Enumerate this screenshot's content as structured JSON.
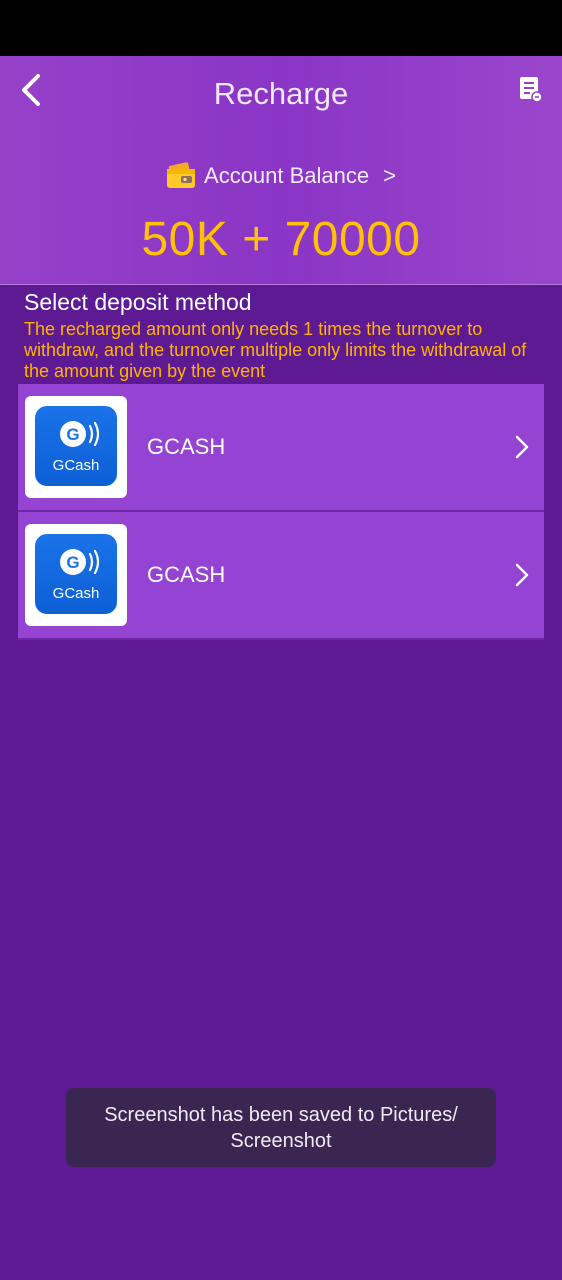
{
  "header": {
    "title": "Recharge",
    "balance_label": "Account Balance",
    "balance_arrow": ">",
    "balance_value": "50K + 70000"
  },
  "deposit": {
    "section_title": "Select deposit method",
    "notice": "The recharged amount only needs 1 times the turnover to withdraw, and the turnover multiple only limits the withdrawal of the amount given by the event",
    "methods": [
      {
        "name": "GCASH",
        "logo_text": "GCash"
      },
      {
        "name": "GCASH",
        "logo_text": "GCash"
      }
    ]
  },
  "toast": {
    "message": "Screenshot has been saved to  Pictures/\nScreenshot"
  },
  "icons": {
    "back": "chevron-left-icon",
    "record": "receipt-icon",
    "wallet": "wallet-icon",
    "method_arrow": "chevron-right-icon"
  },
  "colors": {
    "accent_gold": "#ffc107",
    "notice_orange": "#ffb300",
    "header_purple": "#8a35c6",
    "page_purple": "#5e1a93",
    "item_purple": "#9443d2",
    "gcash_blue": "#1a73e8"
  }
}
